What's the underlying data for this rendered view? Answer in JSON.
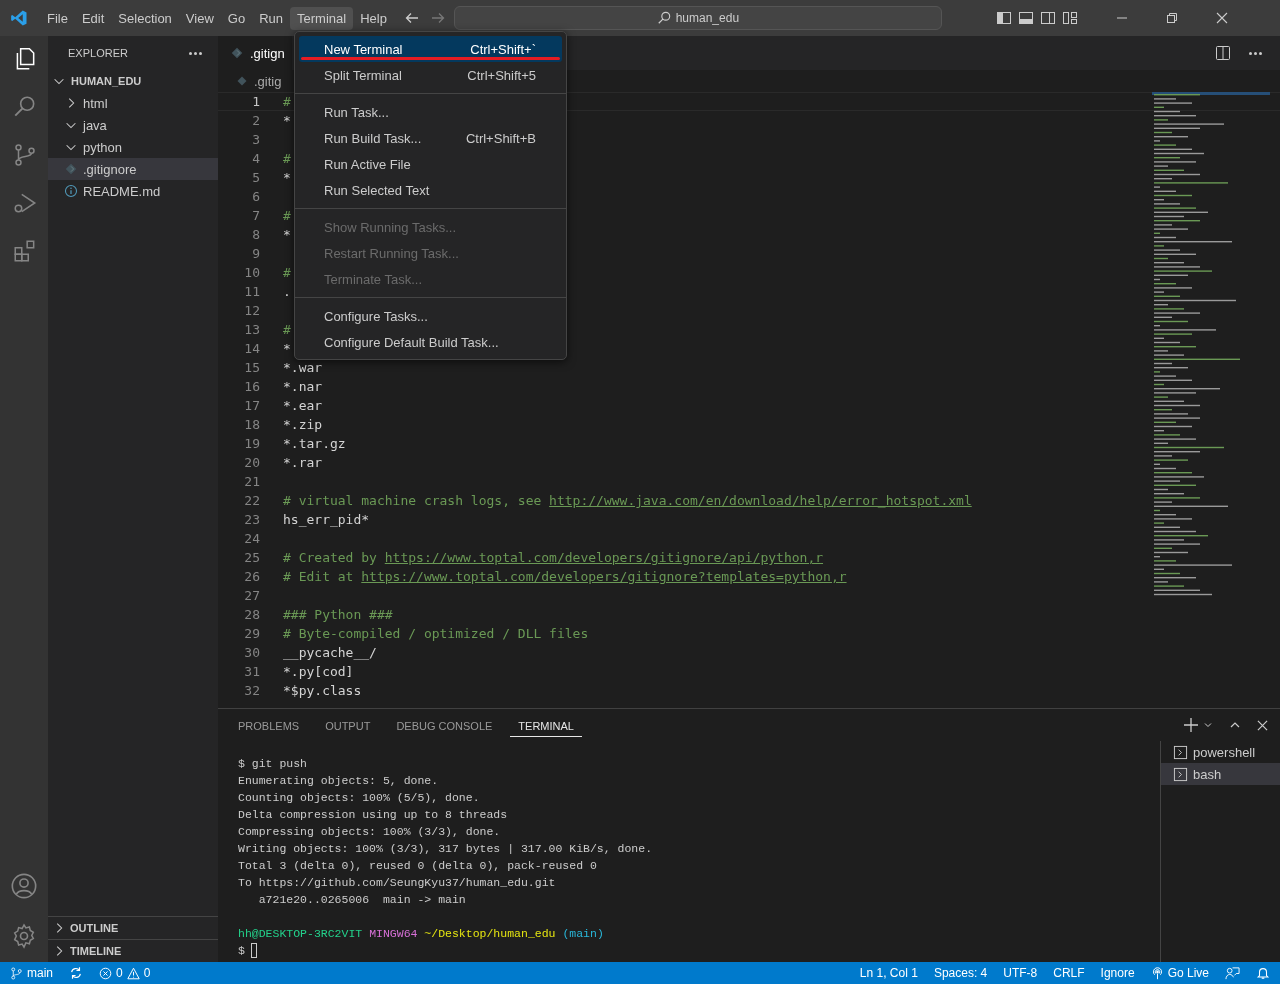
{
  "title_bar": {
    "menus": [
      {
        "label": "File",
        "selected": false
      },
      {
        "label": "Edit",
        "selected": false
      },
      {
        "label": "Selection",
        "selected": false
      },
      {
        "label": "View",
        "selected": false
      },
      {
        "label": "Go",
        "selected": false
      },
      {
        "label": "Run",
        "selected": false
      },
      {
        "label": "Terminal",
        "selected": true
      },
      {
        "label": "Help",
        "selected": false
      }
    ],
    "search": {
      "value": "human_edu"
    }
  },
  "terminal_menu": {
    "groups": [
      [
        {
          "label": "New Terminal",
          "shortcut": "Ctrl+Shift+`",
          "disabled": false,
          "selected": true,
          "underlined": true
        },
        {
          "label": "Split Terminal",
          "shortcut": "Ctrl+Shift+5",
          "disabled": false,
          "selected": false,
          "underlined": false
        }
      ],
      [
        {
          "label": "Run Task...",
          "disabled": false,
          "selected": false,
          "underlined": false
        },
        {
          "label": "Run Build Task...",
          "shortcut": "Ctrl+Shift+B",
          "disabled": false,
          "selected": false,
          "underlined": false
        },
        {
          "label": "Run Active File",
          "disabled": false,
          "selected": false,
          "underlined": false
        },
        {
          "label": "Run Selected Text",
          "disabled": false,
          "selected": false,
          "underlined": false
        }
      ],
      [
        {
          "label": "Show Running Tasks...",
          "disabled": true,
          "selected": false,
          "underlined": false
        },
        {
          "label": "Restart Running Task...",
          "disabled": true,
          "selected": false,
          "underlined": false
        },
        {
          "label": "Terminate Task...",
          "disabled": true,
          "selected": false,
          "underlined": false
        }
      ],
      [
        {
          "label": "Configure Tasks...",
          "disabled": false,
          "selected": false,
          "underlined": false
        },
        {
          "label": "Configure Default Build Task...",
          "disabled": false,
          "selected": false,
          "underlined": false
        }
      ]
    ]
  },
  "sidebar": {
    "title": "EXPLORER",
    "tree": [
      {
        "label": "HUMAN_EDU",
        "expanded": true,
        "children": [
          {
            "label": "html",
            "kind": "folder",
            "expanded": false,
            "selected": false
          },
          {
            "label": "java",
            "kind": "folder",
            "expanded": true,
            "selected": false
          },
          {
            "label": "python",
            "kind": "folder",
            "expanded": true,
            "selected": false
          },
          {
            "label": ".gitignore",
            "kind": "gitignore",
            "selected": true
          },
          {
            "label": "README.md",
            "kind": "readme",
            "selected": false
          }
        ]
      }
    ],
    "sections": [
      {
        "label": "OUTLINE",
        "expanded": false
      },
      {
        "label": "TIMELINE",
        "expanded": false
      }
    ]
  },
  "editor": {
    "tab": ".gitign",
    "breadcrumb": ".gitig",
    "lines": [
      {
        "number": "1",
        "current": true,
        "segments": [
          {
            "kind": "comment",
            "text": "#"
          }
        ]
      },
      {
        "number": "2",
        "current": false,
        "segments": [
          {
            "kind": "plain",
            "text": "*"
          }
        ]
      },
      {
        "number": "3",
        "current": false
      },
      {
        "number": "4",
        "current": false,
        "segments": [
          {
            "kind": "comment",
            "text": "#"
          }
        ]
      },
      {
        "number": "5",
        "current": false,
        "segments": [
          {
            "kind": "plain",
            "text": "*"
          }
        ]
      },
      {
        "number": "6",
        "current": false
      },
      {
        "number": "7",
        "current": false,
        "segments": [
          {
            "kind": "comment",
            "text": "#"
          }
        ]
      },
      {
        "number": "8",
        "current": false,
        "segments": [
          {
            "kind": "plain",
            "text": "*"
          }
        ]
      },
      {
        "number": "9",
        "current": false
      },
      {
        "number": "10",
        "current": false,
        "segments": [
          {
            "kind": "comment",
            "text": "#"
          }
        ]
      },
      {
        "number": "11",
        "current": false,
        "segments": [
          {
            "kind": "plain",
            "text": "."
          }
        ]
      },
      {
        "number": "12",
        "current": false
      },
      {
        "number": "13",
        "current": false,
        "segments": [
          {
            "kind": "comment",
            "text": "#"
          }
        ]
      },
      {
        "number": "14",
        "current": false,
        "segments": [
          {
            "kind": "plain",
            "text": "*"
          }
        ]
      },
      {
        "number": "15",
        "current": false,
        "segments": [
          {
            "kind": "plain",
            "text": "*.war"
          }
        ]
      },
      {
        "number": "16",
        "current": false,
        "segments": [
          {
            "kind": "plain",
            "text": "*.nar"
          }
        ]
      },
      {
        "number": "17",
        "current": false,
        "segments": [
          {
            "kind": "plain",
            "text": "*.ear"
          }
        ]
      },
      {
        "number": "18",
        "current": false,
        "segments": [
          {
            "kind": "plain",
            "text": "*.zip"
          }
        ]
      },
      {
        "number": "19",
        "current": false,
        "segments": [
          {
            "kind": "plain",
            "text": "*.tar.gz"
          }
        ]
      },
      {
        "number": "20",
        "current": false,
        "segments": [
          {
            "kind": "plain",
            "text": "*.rar"
          }
        ]
      },
      {
        "number": "21",
        "current": false
      },
      {
        "number": "22",
        "current": false,
        "segments": [
          {
            "kind": "comment",
            "text": "# virtual machine crash logs, see "
          },
          {
            "kind": "link",
            "text": "http://www.java.com/en/download/help/error_hotspot.xml"
          }
        ]
      },
      {
        "number": "23",
        "current": false,
        "segments": [
          {
            "kind": "plain",
            "text": "hs_err_pid*"
          }
        ]
      },
      {
        "number": "24",
        "current": false
      },
      {
        "number": "25",
        "current": false,
        "segments": [
          {
            "kind": "comment",
            "text": "# Created by "
          },
          {
            "kind": "link",
            "text": "https://www.toptal.com/developers/gitignore/api/python,r"
          }
        ]
      },
      {
        "number": "26",
        "current": false,
        "segments": [
          {
            "kind": "comment",
            "text": "# Edit at "
          },
          {
            "kind": "link",
            "text": "https://www.toptal.com/developers/gitignore?templates=python,r"
          }
        ]
      },
      {
        "number": "27",
        "current": false
      },
      {
        "number": "28",
        "current": false,
        "segments": [
          {
            "kind": "comment",
            "text": "### Python ###"
          }
        ]
      },
      {
        "number": "29",
        "current": false,
        "segments": [
          {
            "kind": "comment",
            "text": "# Byte-compiled / optimized / DLL files"
          }
        ]
      },
      {
        "number": "30",
        "current": false,
        "segments": [
          {
            "kind": "plain",
            "text": "__pycache__/"
          }
        ]
      },
      {
        "number": "31",
        "current": false,
        "segments": [
          {
            "kind": "plain",
            "text": "*.py[cod]"
          }
        ]
      },
      {
        "number": "32",
        "current": false,
        "segments": [
          {
            "kind": "plain",
            "text": "*$py.class"
          }
        ]
      }
    ]
  },
  "panel": {
    "tabs": [
      {
        "label": "PROBLEMS",
        "selected": false
      },
      {
        "label": "OUTPUT",
        "selected": false
      },
      {
        "label": "DEBUG CONSOLE",
        "selected": false
      },
      {
        "label": "TERMINAL",
        "selected": true
      }
    ],
    "terminal_lines": [
      "$ git push",
      "Enumerating objects: 5, done.",
      "Counting objects: 100% (5/5), done.",
      "Delta compression using up to 8 threads",
      "Compressing objects: 100% (3/3), done.",
      "Writing objects: 100% (3/3), 317 bytes | 317.00 KiB/s, done.",
      "Total 3 (delta 0), reused 0 (delta 0), pack-reused 0",
      "To https://github.com/SeungKyu37/human_edu.git",
      "   a721e20..0265006  main -> main"
    ],
    "prompt": [
      {
        "text": "hh@DESKTOP-3RC2VIT",
        "color": "#23d18b"
      },
      {
        "text": "MINGW64",
        "color": "#d670d6"
      },
      {
        "text": "~/Desktop/human_edu",
        "color": "#e5e510"
      },
      {
        "text": "(main)",
        "color": "#29b8db"
      }
    ],
    "input_prompt": "$",
    "terminals": [
      {
        "label": "powershell",
        "selected": false
      },
      {
        "label": "bash",
        "selected": true
      }
    ]
  },
  "status_bar": {
    "branch": "main",
    "errors": "0",
    "warnings": "0",
    "right": [
      "Ln 1, Col 1",
      "Spaces: 4",
      "UTF-8",
      "CRLF",
      "Ignore"
    ],
    "go_live": "Go Live"
  }
}
